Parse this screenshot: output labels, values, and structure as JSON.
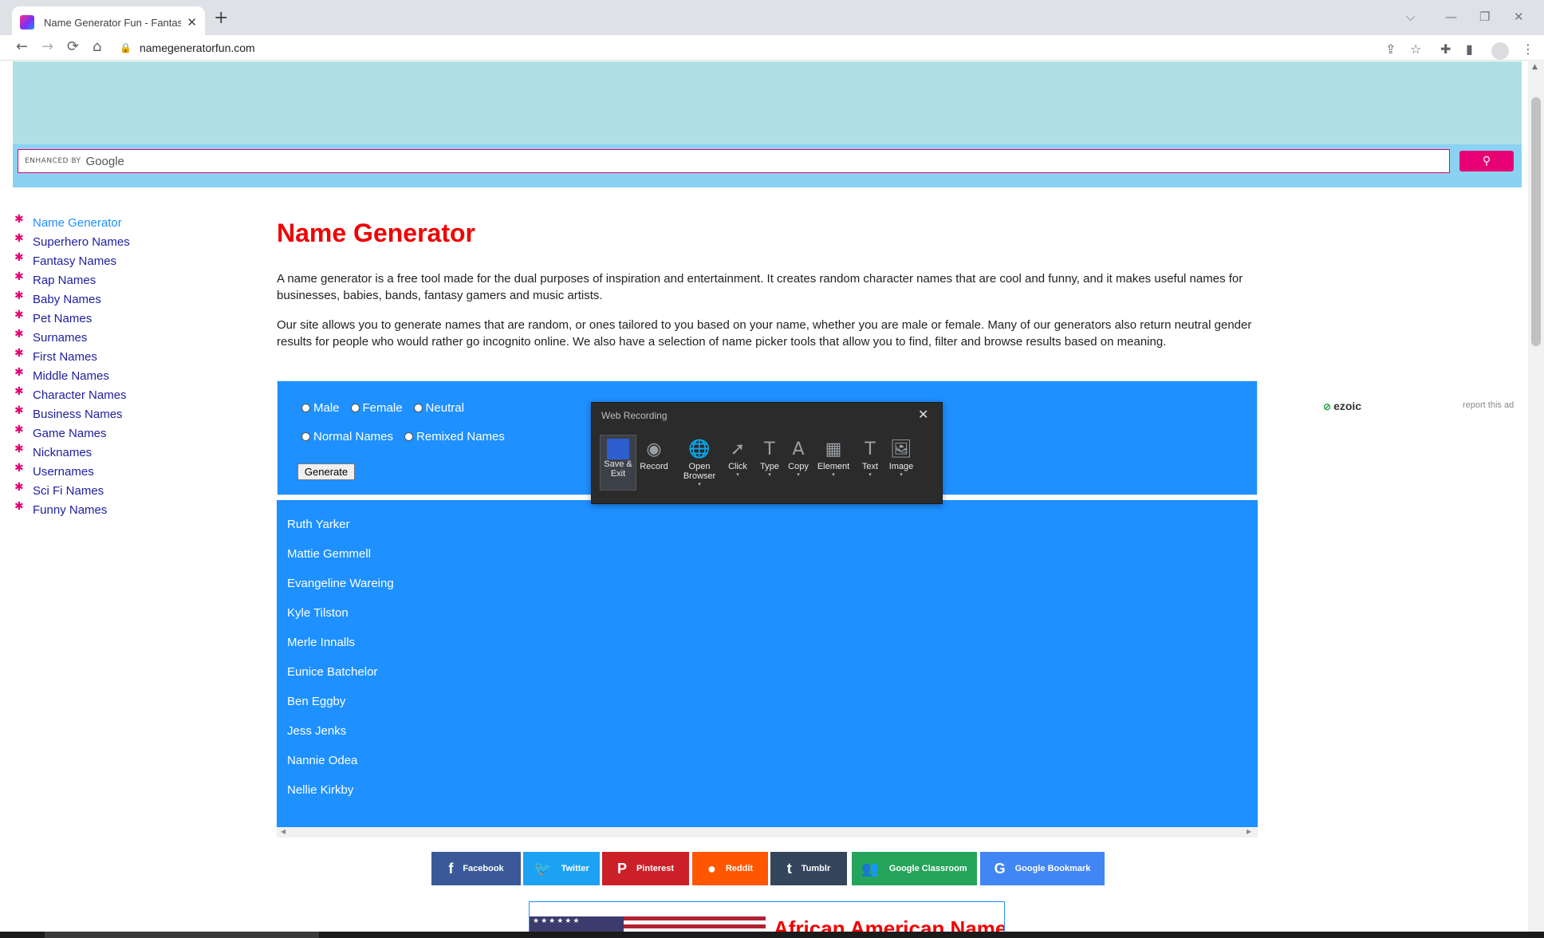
{
  "browser": {
    "tab_title": "Name Generator Fun - Fantasy a",
    "tab_close": "✕",
    "new_tab": "+",
    "url": "namegeneratorfun.com",
    "window_controls": {
      "chevron": "⌵",
      "minimize": "—",
      "restore": "❐",
      "close": "✕"
    },
    "nav": {
      "back": "←",
      "forward": "→",
      "reload": "⟳",
      "home": "⌂"
    }
  },
  "search": {
    "enhanced_by": "ENHANCED BY",
    "google": "Google",
    "button_icon": "search-icon"
  },
  "sidebar": {
    "items": [
      {
        "label": "Name Generator",
        "active": true
      },
      {
        "label": "Superhero Names"
      },
      {
        "label": "Fantasy Names"
      },
      {
        "label": "Rap Names"
      },
      {
        "label": "Baby Names"
      },
      {
        "label": "Pet Names"
      },
      {
        "label": "Surnames"
      },
      {
        "label": "First Names"
      },
      {
        "label": "Middle Names"
      },
      {
        "label": "Character Names"
      },
      {
        "label": "Business Names"
      },
      {
        "label": "Game Names"
      },
      {
        "label": "Nicknames"
      },
      {
        "label": "Usernames"
      },
      {
        "label": "Sci Fi Names"
      },
      {
        "label": "Funny Names"
      }
    ]
  },
  "main": {
    "title": "Name Generator",
    "paragraph1": "A name generator is a free tool made for the dual purposes of inspiration and entertainment. It creates random character names that are cool and funny, and it makes useful names for businesses, babies, bands, fantasy gamers and music artists.",
    "paragraph2": "Our site allows you to generate names that are random, or ones tailored to you based on your name, whether you are male or female. Many of our generators also return neutral gender results for people who would rather go incognito online. We also have a selection of name picker tools that allow you to find, filter and browse results based on meaning."
  },
  "generator": {
    "gender_options": [
      "Male",
      "Female",
      "Neutral"
    ],
    "type_options": [
      "Normal Names",
      "Remixed Names"
    ],
    "generate_label": "Generate"
  },
  "results": [
    "Ruth Yarker",
    "Mattie Gemmell",
    "Evangeline Wareing",
    "Kyle Tilston",
    "Merle Innalls",
    "Eunice Batchelor",
    "Ben Eggby",
    "Jess Jenks",
    "Nannie Odea",
    "Nellie Kirkby"
  ],
  "ads": {
    "ezoic": "ezoic",
    "report": "report this ad"
  },
  "share_buttons": [
    {
      "label": "Facebook",
      "icon": "facebook-icon",
      "glyph": "f",
      "color": "#3b5998"
    },
    {
      "label": "Twitter",
      "icon": "twitter-icon",
      "glyph": "🐦",
      "color": "#1da1f2"
    },
    {
      "label": "Pinterest",
      "icon": "pinterest-icon",
      "glyph": "P",
      "color": "#cb2027"
    },
    {
      "label": "Reddit",
      "icon": "reddit-icon",
      "glyph": "●",
      "color": "#ff5700"
    },
    {
      "label": "Tumblr",
      "icon": "tumblr-icon",
      "glyph": "t",
      "color": "#35465c"
    },
    {
      "label": "Google Classroom",
      "icon": "classroom-icon",
      "glyph": "👥",
      "color": "#25a45c"
    },
    {
      "label": "Google Bookmark",
      "icon": "google-icon",
      "glyph": "G",
      "color": "#4285f4"
    }
  ],
  "promo": {
    "title": "African American Name"
  },
  "recorder": {
    "title": "Web Recording",
    "close": "✕",
    "tools": [
      {
        "label": "Save & Exit",
        "icon": "save-icon"
      },
      {
        "label": "Record",
        "icon": "record-icon"
      },
      {
        "label": "Open Browser",
        "icon": "globe-icon"
      },
      {
        "label": "Click",
        "icon": "click-icon"
      },
      {
        "label": "Type",
        "icon": "type-icon"
      },
      {
        "label": "Copy",
        "icon": "copy-icon"
      },
      {
        "label": "Element",
        "icon": "element-icon"
      },
      {
        "label": "Text",
        "icon": "text-icon"
      },
      {
        "label": "Image",
        "icon": "image-icon"
      }
    ]
  }
}
